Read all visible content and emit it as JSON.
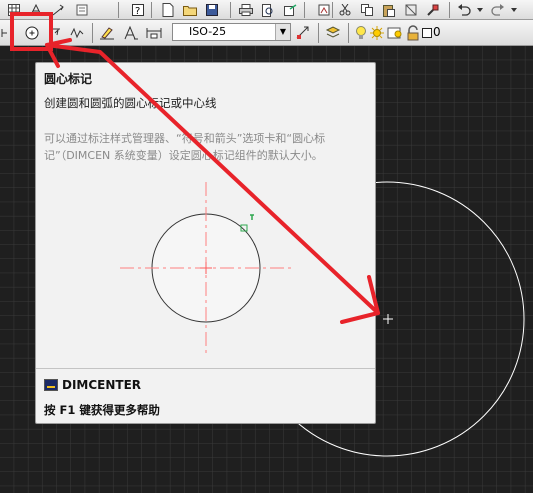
{
  "toolbar2": {
    "dimstyle_value": "ISO-25",
    "layer_value": "0"
  },
  "tooltip": {
    "title": "圆心标记",
    "description": "创建圆和圆弧的圆心标记或中心线",
    "long_description": "可以通过标注样式管理器、“符号和箭头”选项卡和“圆心标记”（DIMCEN 系统变量）设定圆心标记组件的默认大小。",
    "command": "DIMCENTER",
    "help": "按 F1 键获得更多帮助"
  },
  "colors": {
    "canvas_bg": "#1f1f1f",
    "grid": "#3a3a3a",
    "annotation_red": "#e8232a",
    "center_mark_red": "#ff8080",
    "drawing_white": "#ffffff"
  },
  "icons": [
    "table-icon",
    "text-edit-icon",
    "help-icon",
    "new-icon",
    "open-icon",
    "save-icon",
    "print-icon",
    "preview-icon",
    "publish-icon",
    "cut-icon",
    "copy-icon",
    "paste-icon",
    "match-properties-icon",
    "undo-icon",
    "redo-icon",
    "dim-aligned-icon",
    "center-mark-icon",
    "dim-jogged-icon",
    "dim-inspect-icon",
    "dim-edit-icon",
    "dim-text-edit-icon",
    "dim-update-icon",
    "dim-style-icon",
    "layer-on-icon",
    "layer-freeze-icon",
    "layer-viewport-icon",
    "layer-lock-icon",
    "layer-color-icon"
  ]
}
